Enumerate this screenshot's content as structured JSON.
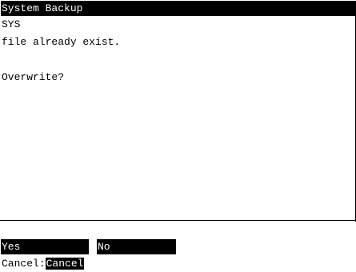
{
  "window": {
    "title": "System Backup"
  },
  "message": {
    "line1": "SYS",
    "line2": "file already exist.",
    "line3": "",
    "line4": "Overwrite?",
    "line5": ""
  },
  "softkeys": {
    "yes_label": "Yes",
    "no_label": "No"
  },
  "cancel": {
    "prompt": "Cancel:",
    "key_label": "Cancel"
  },
  "colors": {
    "background": "#ffffff",
    "foreground": "#000000",
    "inverse_background": "#000000",
    "inverse_foreground": "#ffffff"
  }
}
